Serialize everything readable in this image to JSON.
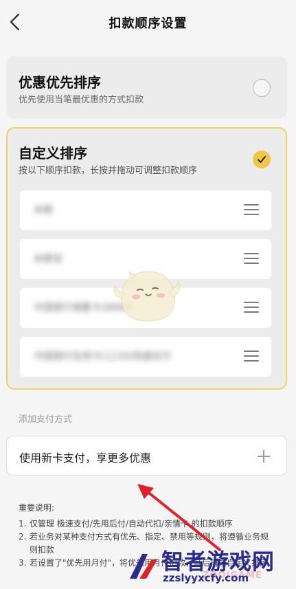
{
  "header": {
    "title": "扣款顺序设置"
  },
  "options": {
    "best_offer": {
      "title": "优惠优先排序",
      "desc": "优先使用当笔最优惠的方式扣款",
      "selected": false
    },
    "custom": {
      "title": "自定义排序",
      "desc": "按以下顺序扣款，长按并拖动可调整扣款顺序",
      "selected": true
    }
  },
  "payment_methods": [
    "余额",
    "余额宝",
    "中国银行储蓄卡(8888)",
    "中国银行信用卡(1234)快捷支付"
  ],
  "add_section": {
    "label": "添加支付方式",
    "new_card_text": "使用新卡支付，享更多优惠"
  },
  "notes": {
    "title": "重要说明:",
    "items": [
      {
        "num": "1.",
        "text": "仅管理 极速支付/先用后付/自动代扣/亲情卡 的扣款顺序"
      },
      {
        "num": "2.",
        "text": "若业务对某种支付方式有优先、指定、禁用等规则，将遵循业务规则扣款"
      },
      {
        "num": "3.",
        "text": "若设置了\"优先用月付\"，将优先用月付扣款，其后再按自定义排序"
      }
    ]
  },
  "watermark": {
    "title": "智者游戏网",
    "url": "zzslyyxcfy.com",
    "ghost": "ZOOIGAME"
  },
  "colors": {
    "accent": "#f0c845",
    "selected_border": "#f0d35a",
    "arrow": "#e0202a",
    "watermark": "#2b2b8c"
  }
}
